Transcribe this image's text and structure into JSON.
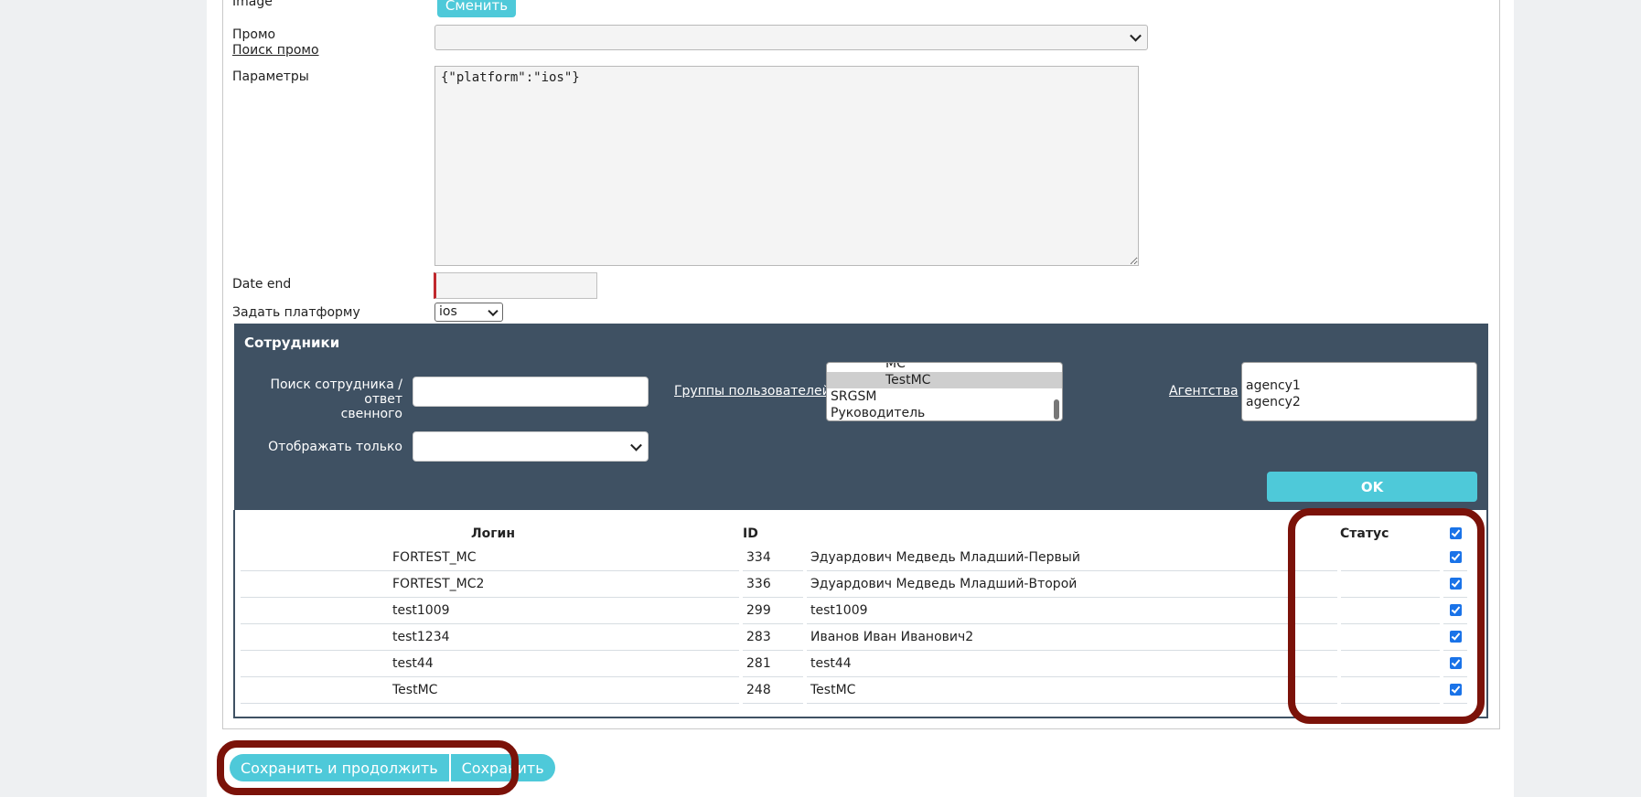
{
  "form": {
    "image_label": "Image",
    "change_button": "Сменить",
    "promo_label": "Промо",
    "promo_search_link": "Поиск промо",
    "promo_value": "",
    "params_label": "Параметры",
    "params_value": "{\"platform\":\"ios\"}",
    "date_end_label": "Date end",
    "date_end_value": "",
    "platform_label": "Задать платформу",
    "platform_value": "ios"
  },
  "employees": {
    "title": "Сотрудники",
    "search_label_line1": "Поиск сотрудника / ответ",
    "search_label_line2": "свенного",
    "search_value": "",
    "show_only_label": "Отображать только",
    "show_only_value": "",
    "user_groups_link": "Группы пользователей",
    "user_groups": [
      {
        "label": "MC",
        "indent": true,
        "selected": false
      },
      {
        "label": "TestMC",
        "indent": true,
        "selected": true
      },
      {
        "label": "SRGSM",
        "indent": false,
        "selected": false
      },
      {
        "label": "Руководитель",
        "indent": false,
        "selected": false
      }
    ],
    "agencies_link": "Агентства",
    "agencies": [
      "agency1",
      "agency2"
    ],
    "ok_button": "OK"
  },
  "table": {
    "headers": {
      "login": "Логин",
      "id": "ID",
      "status": "Статус"
    },
    "header_checkbox_checked": true,
    "rows": [
      {
        "login": "FORTEST_MC",
        "id": "334",
        "name": "Эдуардович Медведь Младший-Первый",
        "checked": true
      },
      {
        "login": "FORTEST_MC2",
        "id": "336",
        "name": "Эдуардович Медведь Младший-Второй",
        "checked": true
      },
      {
        "login": "test1009",
        "id": "299",
        "name": "test1009",
        "checked": true
      },
      {
        "login": "test1234",
        "id": "283",
        "name": "Иванов Иван Иванович2",
        "checked": true
      },
      {
        "login": "test44",
        "id": "281",
        "name": "test44",
        "checked": true
      },
      {
        "login": "TestMC",
        "id": "248",
        "name": "TestMC",
        "checked": true
      }
    ]
  },
  "actions": {
    "save_continue": "Сохранить и продолжить",
    "save": "Сохранить"
  },
  "colors": {
    "accent": "#4ec9d9",
    "panel": "#3f5163",
    "highlight": "#7b1209",
    "checkbox": "#1a73e8"
  }
}
